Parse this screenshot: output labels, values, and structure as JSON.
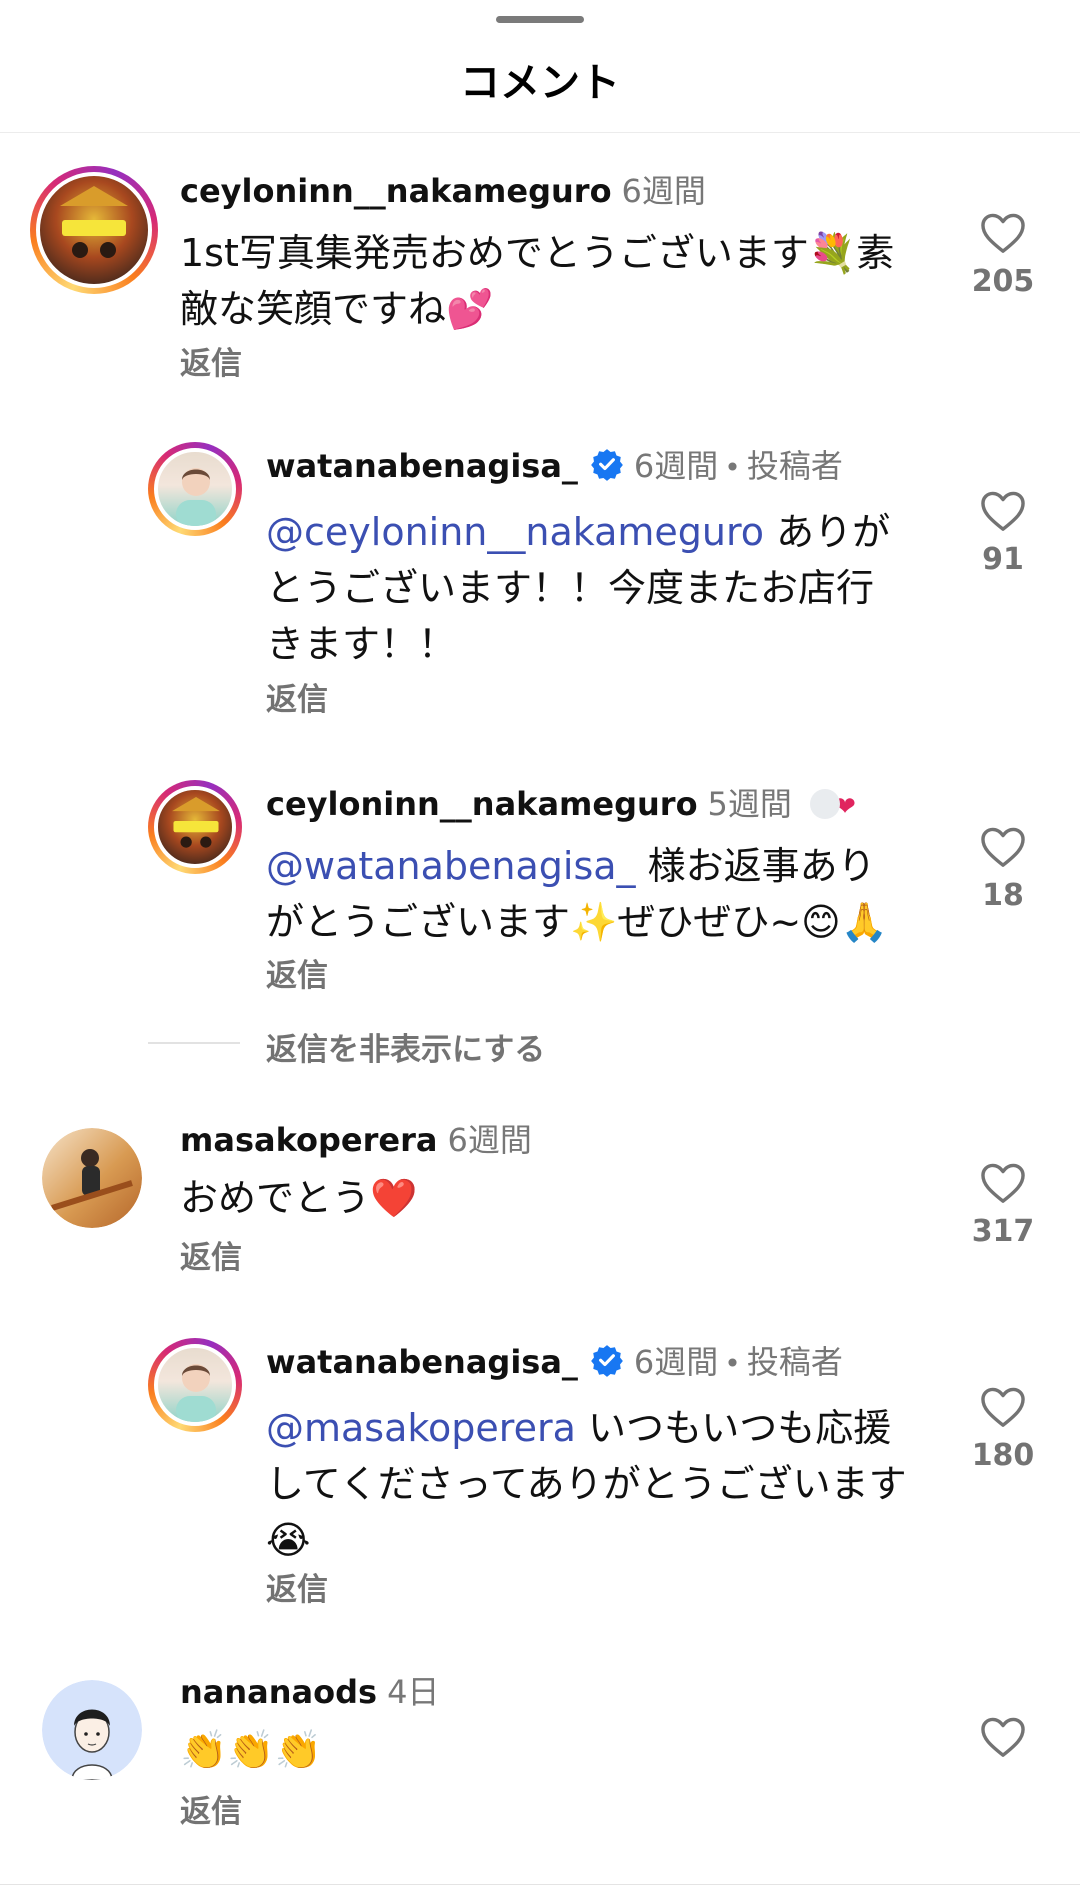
{
  "sheet": {
    "title": "コメント"
  },
  "colors": {
    "mention": "#3b4fb2",
    "verified": "#1877f2",
    "muted": "#737373"
  },
  "comments": [
    {
      "username": "ceyloninn__nakameguro",
      "time": "6週間",
      "avatar_label": "ceylon inn",
      "text": "1st写真集発売おめでとうございます💐素敵な笑顔ですね💕",
      "reply_label": "返信",
      "likes": "205",
      "replies": [
        {
          "username": "watanabenagisa_",
          "verified": true,
          "time": "6週間",
          "author_tag": "投稿者",
          "mention": "@ceyloninn__nakameguro",
          "text": " ありがとうございます！！今度またお店行きます！！",
          "reply_label": "返信",
          "likes": "91"
        },
        {
          "username": "ceyloninn__nakameguro",
          "time": "5週間",
          "liked_by_author": "❤",
          "avatar_label": "ceylon inn",
          "mention": "@watanabenagisa_",
          "text": " 様お返事ありがとうございます✨ぜひぜひ~😊🙏",
          "reply_label": "返信",
          "likes": "18"
        }
      ],
      "hide_replies_label": "返信を非表示にする"
    },
    {
      "username": "masakoperera",
      "time": "6週間",
      "text": "おめでとう❤️",
      "reply_label": "返信",
      "likes": "317",
      "replies": [
        {
          "username": "watanabenagisa_",
          "verified": true,
          "time": "6週間",
          "author_tag": "投稿者",
          "mention": "@masakoperera",
          "text": " いつもいつも応援してくださってありがとうございます😭",
          "reply_label": "返信",
          "likes": "180"
        }
      ]
    },
    {
      "username": "nananaods",
      "time": "4日",
      "text": "👏👏👏",
      "reply_label": "返信",
      "likes": ""
    }
  ]
}
